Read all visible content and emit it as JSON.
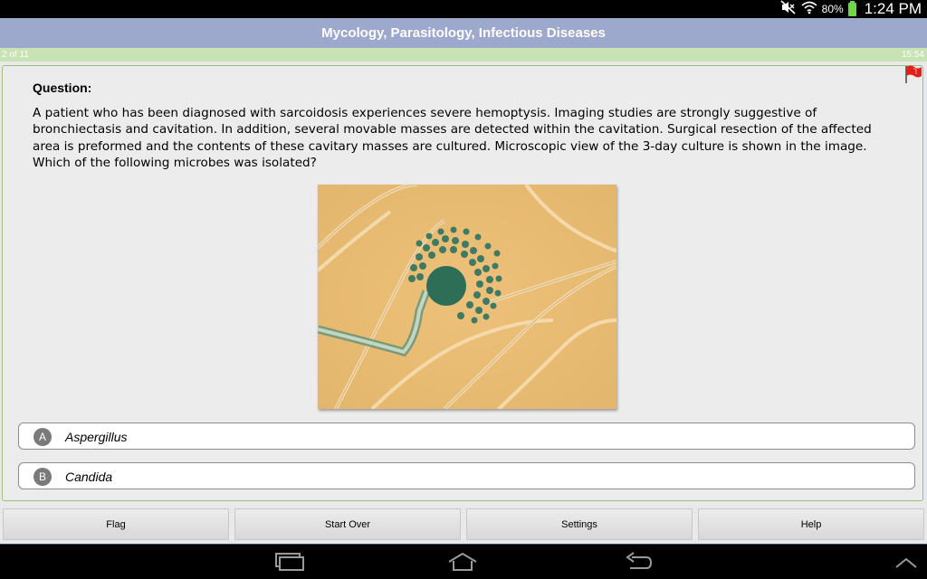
{
  "status": {
    "battery": "80%",
    "time": "1:24 PM"
  },
  "header": {
    "title": "Mycology, Parasitology, Infectious Diseases"
  },
  "progress": {
    "count": "2 of 11",
    "timer": "15:54"
  },
  "question": {
    "heading": "Question:",
    "text": "A patient who has been diagnosed with sarcoidosis experiences severe hemoptysis. Imaging studies are strongly suggestive of bronchiectasis and cavitation. In addition, several movable masses are detected within the cavitation. Surgical resection of the affected area is preformed and the contents of these cavitary masses are cultured. Microscopic view of the 3-day culture is shown in the image. Which of the following microbes was isolated?"
  },
  "answers": [
    {
      "letter": "A",
      "text": "Aspergillus"
    },
    {
      "letter": "B",
      "text": "Candida"
    }
  ],
  "buttons": {
    "flag": "Flag",
    "start_over": "Start Over",
    "settings": "Settings",
    "help": "Help"
  },
  "icons": {
    "mute": "mute-icon",
    "wifi": "wifi-icon",
    "battery": "battery-icon",
    "flag_marker": "red-flag-icon",
    "recent_apps": "recent-apps-icon",
    "home": "home-icon",
    "back": "back-icon",
    "collapse": "chevron-up-icon"
  },
  "colors": {
    "title_bar": "#9ca8cc",
    "progress_bar": "#c7e2b3",
    "culture_background": "#e6bd72",
    "flag_red": "#e0201b"
  }
}
